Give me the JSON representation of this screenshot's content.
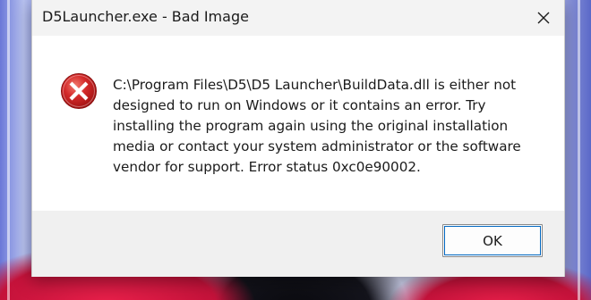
{
  "window": {
    "title": "D5Launcher.exe - Bad Image"
  },
  "titlebar": {
    "close_icon": "close-icon"
  },
  "dialog": {
    "icon": "error-icon",
    "message": "C:\\Program Files\\D5\\D5 Launcher\\BuildData.dll is either not\ndesigned to run on Windows or it contains an error. Try\ninstalling the program again using the original installation\nmedia or contact your system administrator or the software\nvendor for support. Error status 0xc0e90002."
  },
  "buttons": {
    "ok_label": "OK"
  },
  "colors": {
    "error_red": "#d42a2a",
    "focus_blue": "#0067c0"
  }
}
